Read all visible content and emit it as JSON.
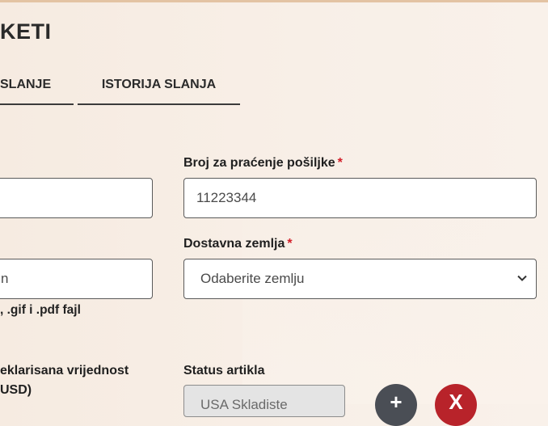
{
  "page": {
    "title": "KETI"
  },
  "tabs": [
    {
      "label": "SLANJE"
    },
    {
      "label": "ISTORIJA SLANJA"
    }
  ],
  "form": {
    "tracking": {
      "label": "Broj za praćenje pošiljke",
      "required": "*",
      "value": "11223344"
    },
    "country": {
      "label": "Dostavna zemlja",
      "required": "*",
      "selected": "Odaberite zemlju"
    },
    "left_input_value": "n",
    "file_note": ", .gif i .pdf fajl",
    "declared": {
      "line1": "eklarisana vrijednost",
      "line2": "USD)"
    },
    "status": {
      "label": "Status artikla",
      "selected": "USA Skladiste"
    }
  },
  "buttons": {
    "add_label": "+",
    "remove_label": "X"
  },
  "colors": {
    "required": "#d21d28",
    "remove": "#b8232a",
    "add": "#4a4e55",
    "accent_line": "#e3c3a3"
  }
}
